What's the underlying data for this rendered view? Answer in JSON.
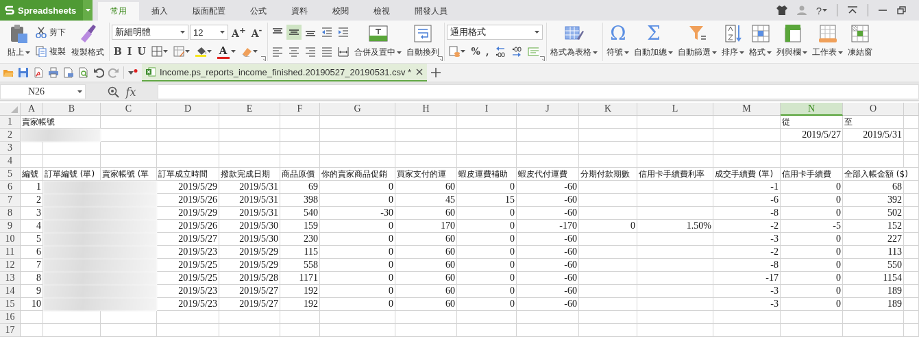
{
  "app": {
    "name": "Spreadsheets"
  },
  "menu_tabs": [
    {
      "label": "常用",
      "selected": true
    },
    {
      "label": "插入",
      "selected": false
    },
    {
      "label": "版面配置",
      "selected": false
    },
    {
      "label": "公式",
      "selected": false
    },
    {
      "label": "資料",
      "selected": false
    },
    {
      "label": "校閱",
      "selected": false
    },
    {
      "label": "檢視",
      "selected": false
    },
    {
      "label": "開發人員",
      "selected": false
    }
  ],
  "help_label": "?",
  "ribbon": [
    {
      "launcher": false,
      "columns": [
        {
          "kind": "large",
          "label": "貼上",
          "dropdown": true
        },
        {
          "kind": "stack",
          "top": [
            {
              "kind": "text",
              "label": "剪下"
            }
          ],
          "bottom": [
            {
              "kind": "text",
              "label": "複製"
            }
          ]
        },
        {
          "kind": "large",
          "label": "複製格式",
          "dropdown": false
        }
      ]
    },
    {
      "launcher": true,
      "columns": [
        {
          "kind": "stack",
          "top": [
            {
              "kind": "fontname",
              "value": "新細明體"
            },
            {
              "kind": "fontsize",
              "value": "12"
            },
            {
              "kind": "glyph",
              "label": "A$^{+}$"
            },
            {
              "kind": "glyph",
              "label": "A$^{-}$"
            }
          ],
          "bottom": [
            {
              "kind": "glyph",
              "label": "B"
            },
            {
              "kind": "glyph",
              "label": "I"
            },
            {
              "kind": "glyph",
              "label": "U"
            },
            {
              "kind": "icon",
              "dropdown": true,
              "selected": false
            },
            {
              "kind": "icon",
              "dropdown": true,
              "selected": false
            },
            {
              "kind": "icon",
              "dropdown": true,
              "selected": false
            },
            {
              "kind": "colorglyph",
              "label": "A",
              "dropdown": true
            },
            {
              "kind": "icon",
              "dropdown": true,
              "selected": false
            }
          ]
        }
      ]
    },
    {
      "launcher": true,
      "columns": [
        {
          "kind": "stack",
          "top": [
            {
              "kind": "icon",
              "dropdown": false,
              "selected": false
            },
            {
              "kind": "icon",
              "dropdown": false,
              "selected": true
            },
            {
              "kind": "icon",
              "dropdown": false,
              "selected": false
            },
            {
              "kind": "icon",
              "dropdown": false,
              "selected": false
            },
            {
              "kind": "icon",
              "dropdown": false,
              "selected": false
            }
          ],
          "bottom": [
            {
              "kind": "icon",
              "dropdown": false,
              "selected": false
            },
            {
              "kind": "icon",
              "dropdown": false,
              "selected": false
            },
            {
              "kind": "icon",
              "dropdown": false,
              "selected": false
            },
            {
              "kind": "icon",
              "dropdown": false,
              "selected": false
            },
            {
              "kind": "icon",
              "dropdown": false,
              "selected": false
            }
          ]
        },
        {
          "kind": "large",
          "label": "合併及置中",
          "dropdown": true
        },
        {
          "kind": "large",
          "label": "自動換列",
          "dropdown": false
        }
      ]
    },
    {
      "launcher": true,
      "columns": [
        {
          "kind": "stack",
          "top": [
            {
              "kind": "numformat",
              "value": "通用格式"
            }
          ],
          "bottom": [
            {
              "kind": "icon",
              "dropdown": true,
              "selected": false
            },
            {
              "kind": "glyph",
              "label": "%"
            },
            {
              "kind": "glyph",
              "label": ","
            },
            {
              "kind": "icon",
              "dropdown": false,
              "selected": false
            },
            {
              "kind": "icon",
              "dropdown": false,
              "selected": false
            },
            {
              "kind": "icon",
              "dropdown": false,
              "selected": false
            }
          ]
        }
      ]
    },
    {
      "launcher": false,
      "columns": [
        {
          "kind": "large",
          "label": "格式為表格",
          "dropdown": true
        }
      ]
    },
    {
      "launcher": false,
      "columns": [
        {
          "kind": "large",
          "label": "符號",
          "dropdown": true,
          "glyph": "Ω"
        },
        {
          "kind": "large",
          "label": "自動加總",
          "dropdown": true,
          "glyph": "Σ"
        },
        {
          "kind": "large",
          "label": "自動篩選",
          "dropdown": true
        },
        {
          "kind": "large",
          "label": "排序",
          "dropdown": true
        },
        {
          "kind": "large",
          "label": "格式",
          "dropdown": true
        },
        {
          "kind": "large",
          "label": "列與欄",
          "dropdown": true
        },
        {
          "kind": "large",
          "label": "工作表",
          "dropdown": true
        },
        {
          "kind": "large",
          "label": "凍結窗",
          "dropdown": false
        }
      ]
    }
  ],
  "document_tab": {
    "title": "Income.ps_reports_income_finished.20190527_20190531.csv *",
    "selected": true
  },
  "formula_bar": {
    "cell_name": "N26",
    "function_label": "fx"
  },
  "columns": [
    {
      "label": "A",
      "selected": false
    },
    {
      "label": "B",
      "selected": false
    },
    {
      "label": "C",
      "selected": false
    },
    {
      "label": "D",
      "selected": false
    },
    {
      "label": "E",
      "selected": false
    },
    {
      "label": "F",
      "selected": false
    },
    {
      "label": "G",
      "selected": false
    },
    {
      "label": "H",
      "selected": false
    },
    {
      "label": "I",
      "selected": false
    },
    {
      "label": "J",
      "selected": false
    },
    {
      "label": "K",
      "selected": false
    },
    {
      "label": "L",
      "selected": false
    },
    {
      "label": "M",
      "selected": false
    },
    {
      "label": "N",
      "selected": true
    },
    {
      "label": "O",
      "selected": false
    }
  ],
  "rows": [
    {
      "number": "1",
      "kind": "text",
      "cells": {
        "A": "賣家帳號",
        "N": "從",
        "O": "至"
      }
    },
    {
      "number": "2",
      "kind": "number",
      "cells": {
        "N": "2019/5/27",
        "O": "2019/5/31"
      },
      "blurred": {
        "A": true,
        "B": true
      }
    },
    {
      "number": "3",
      "kind": "text",
      "cells": {}
    },
    {
      "number": "4",
      "kind": "text",
      "cells": {}
    },
    {
      "number": "5",
      "kind": "text",
      "cells": {
        "A": "編號",
        "B": "訂單編號 (單)",
        "C": "賣家帳號 (單",
        "D": "訂單成立時間",
        "E": "撥款完成日期",
        "F": "商品原價",
        "G": "你的賣家商品促銷",
        "H": "買家支付的運",
        "I": "蝦皮運費補助",
        "J": "蝦皮代付運費",
        "K": "分期付款期數",
        "L": "信用卡手續費利率",
        "M": "成交手續費 (單)",
        "N": "信用卡手續費",
        "O": "全部入帳金額 ($)"
      }
    },
    {
      "number": "6",
      "kind": "number",
      "cells": {
        "A": "1",
        "D": "2019/5/29",
        "E": "2019/5/31",
        "F": "69",
        "G": "0",
        "H": "60",
        "I": "0",
        "J": "-60",
        "M": "-1",
        "N": "0",
        "O": "68"
      },
      "blurred": {
        "B": true,
        "C": true
      }
    },
    {
      "number": "7",
      "kind": "number",
      "cells": {
        "A": "2",
        "D": "2019/5/26",
        "E": "2019/5/31",
        "F": "398",
        "G": "0",
        "H": "45",
        "I": "15",
        "J": "-60",
        "M": "-6",
        "N": "0",
        "O": "392"
      },
      "blurred": {
        "B": true,
        "C": true
      }
    },
    {
      "number": "8",
      "kind": "number",
      "cells": {
        "A": "3",
        "D": "2019/5/29",
        "E": "2019/5/31",
        "F": "540",
        "G": "-30",
        "H": "60",
        "I": "0",
        "J": "-60",
        "M": "-8",
        "N": "0",
        "O": "502"
      },
      "blurred": {
        "B": true,
        "C": true
      }
    },
    {
      "number": "9",
      "kind": "number",
      "cells": {
        "A": "4",
        "D": "2019/5/26",
        "E": "2019/5/30",
        "F": "159",
        "G": "0",
        "H": "170",
        "I": "0",
        "J": "-170",
        "K": "0",
        "L": "1.50%",
        "M": "-2",
        "N": "-5",
        "O": "152"
      },
      "blurred": {
        "B": true,
        "C": true
      }
    },
    {
      "number": "10",
      "kind": "number",
      "cells": {
        "A": "5",
        "D": "2019/5/27",
        "E": "2019/5/30",
        "F": "230",
        "G": "0",
        "H": "60",
        "I": "0",
        "J": "-60",
        "M": "-3",
        "N": "0",
        "O": "227"
      },
      "blurred": {
        "B": true,
        "C": true
      }
    },
    {
      "number": "11",
      "kind": "number",
      "cells": {
        "A": "6",
        "D": "2019/5/23",
        "E": "2019/5/29",
        "F": "115",
        "G": "0",
        "H": "60",
        "I": "0",
        "J": "-60",
        "M": "-2",
        "N": "0",
        "O": "113"
      },
      "blurred": {
        "B": true,
        "C": true
      }
    },
    {
      "number": "12",
      "kind": "number",
      "cells": {
        "A": "7",
        "D": "2019/5/25",
        "E": "2019/5/29",
        "F": "558",
        "G": "0",
        "H": "60",
        "I": "0",
        "J": "-60",
        "M": "-8",
        "N": "0",
        "O": "550"
      },
      "blurred": {
        "B": true,
        "C": true
      }
    },
    {
      "number": "13",
      "kind": "number",
      "cells": {
        "A": "8",
        "D": "2019/5/25",
        "E": "2019/5/28",
        "F": "1171",
        "G": "0",
        "H": "60",
        "I": "0",
        "J": "-60",
        "M": "-17",
        "N": "0",
        "O": "1154"
      },
      "blurred": {
        "B": true,
        "C": true
      }
    },
    {
      "number": "14",
      "kind": "number",
      "cells": {
        "A": "9",
        "D": "2019/5/23",
        "E": "2019/5/27",
        "F": "192",
        "G": "0",
        "H": "60",
        "I": "0",
        "J": "-60",
        "M": "-3",
        "N": "0",
        "O": "189"
      },
      "blurred": {
        "B": true,
        "C": true
      }
    },
    {
      "number": "15",
      "kind": "number",
      "cells": {
        "A": "10",
        "D": "2019/5/23",
        "E": "2019/5/27",
        "F": "192",
        "G": "0",
        "H": "60",
        "I": "0",
        "J": "-60",
        "M": "-3",
        "N": "0",
        "O": "189"
      },
      "blurred": {
        "B": true,
        "C": true
      }
    },
    {
      "number": "16",
      "kind": "text",
      "cells": {}
    },
    {
      "number": "17",
      "kind": "text",
      "cells": {}
    }
  ]
}
